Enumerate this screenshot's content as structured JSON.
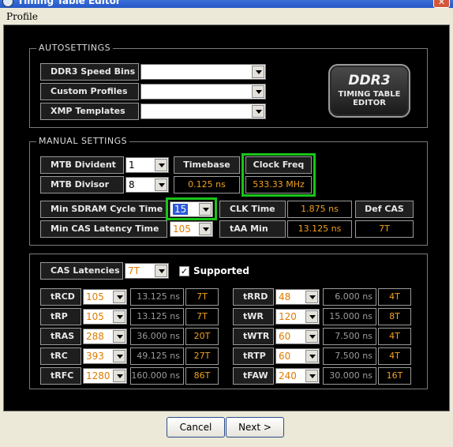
{
  "window": {
    "title": "Timing Table Editor",
    "close_glyph": "✕"
  },
  "menu": {
    "profile": "Profile"
  },
  "autosettings": {
    "title": "AUTOSETTINGS",
    "rows": [
      {
        "label": "DDR3 Speed Bins",
        "value": ""
      },
      {
        "label": "Custom Profiles",
        "value": ""
      },
      {
        "label": "XMP Templates",
        "value": ""
      }
    ]
  },
  "logo": {
    "line1": "DDR3",
    "line2": "TIMING TABLE",
    "line3": "EDITOR"
  },
  "manual": {
    "title": "MANUAL SETTINGS",
    "mtb_divident": {
      "label": "MTB Divident",
      "value": "1"
    },
    "mtb_divisor": {
      "label": "MTB Divisor",
      "value": "8"
    },
    "timebase": {
      "label": "Timebase",
      "value": "0.125 ns"
    },
    "clock_freq": {
      "label": "Clock Freq",
      "value": "533.33 MHz"
    },
    "min_sdram": {
      "label": "Min SDRAM Cycle Time",
      "value": "15"
    },
    "min_cas": {
      "label": "Min CAS Latency Time",
      "value": "105"
    },
    "clk_time": {
      "label": "CLK Time",
      "value": "1.875 ns"
    },
    "taa_min": {
      "label": "tAA Min",
      "value": "13.125 ns"
    },
    "def_cas": {
      "label": "Def CAS",
      "value": "7T"
    }
  },
  "timings": {
    "cas_latencies": {
      "label": "CAS Latencies",
      "value": "7T"
    },
    "supported": {
      "label": "Supported",
      "checked": true,
      "mark": "✓"
    },
    "left": [
      {
        "name": "tRCD",
        "value": "105",
        "ns": "13.125 ns",
        "t": "7T"
      },
      {
        "name": "tRP",
        "value": "105",
        "ns": "13.125 ns",
        "t": "7T"
      },
      {
        "name": "tRAS",
        "value": "288",
        "ns": "36.000 ns",
        "t": "20T"
      },
      {
        "name": "tRC",
        "value": "393",
        "ns": "49.125 ns",
        "t": "27T"
      },
      {
        "name": "tRFC",
        "value": "1280",
        "ns": "160.000 ns",
        "t": "86T"
      }
    ],
    "right": [
      {
        "name": "tRRD",
        "value": "48",
        "ns": "6.000 ns",
        "t": "4T"
      },
      {
        "name": "tWR",
        "value": "120",
        "ns": "15.000 ns",
        "t": "8T"
      },
      {
        "name": "tWTR",
        "value": "60",
        "ns": "7.500 ns",
        "t": "4T"
      },
      {
        "name": "tRTP",
        "value": "60",
        "ns": "7.500 ns",
        "t": "4T"
      },
      {
        "name": "tFAW",
        "value": "240",
        "ns": "30.000 ns",
        "t": "16T"
      }
    ]
  },
  "buttons": {
    "cancel": "Cancel",
    "next": "Next >"
  },
  "colors": {
    "highlight": "#19c419",
    "value_orange": "#f0a020",
    "panel_bg": "#000000"
  }
}
